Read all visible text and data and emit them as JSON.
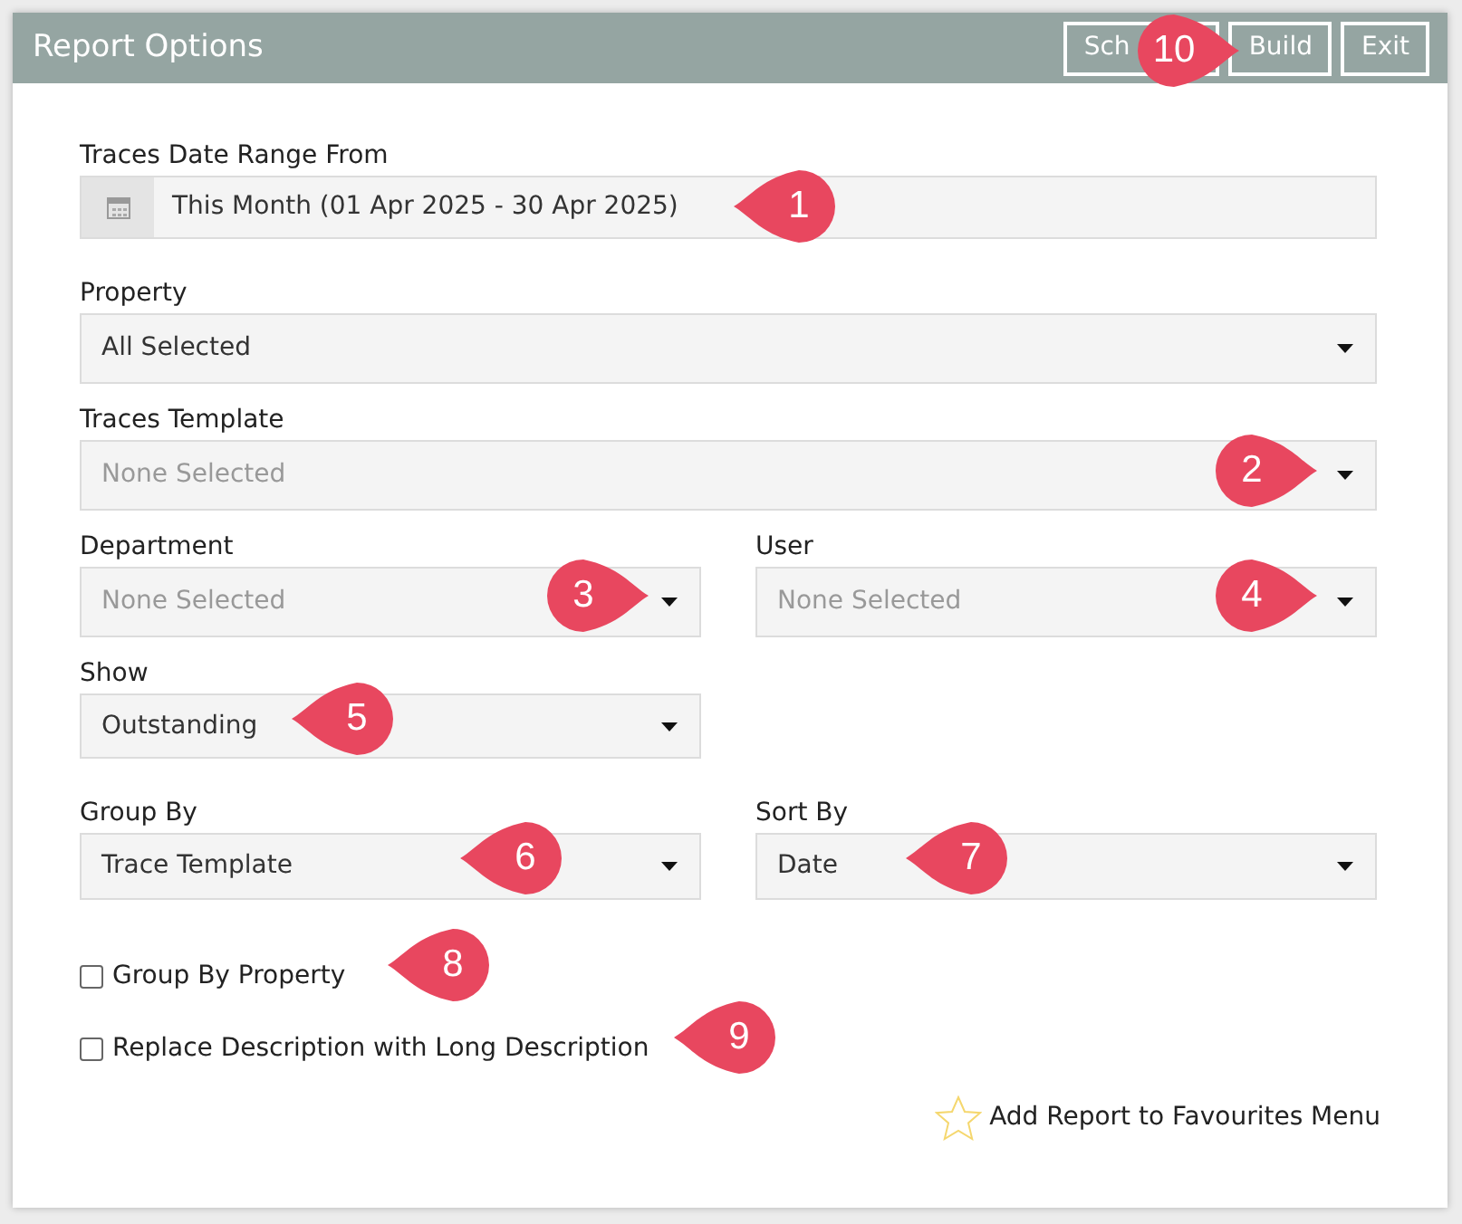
{
  "window": {
    "title": "Report Options"
  },
  "header_buttons": [
    {
      "label": "Sch"
    },
    {
      "label": "Build"
    },
    {
      "label": "Exit"
    }
  ],
  "rows": [
    {
      "kind": "full",
      "fields": [
        {
          "kind": "date",
          "label": "Traces Date Range From",
          "value": "This Month (01 Apr 2025 - 30 Apr 2025)"
        }
      ]
    },
    {
      "kind": "full",
      "fields": [
        {
          "kind": "select",
          "label": "Property",
          "value": "All Selected"
        }
      ]
    },
    {
      "kind": "full",
      "fields": [
        {
          "kind": "select",
          "label": "Traces Template",
          "placeholder": "None Selected"
        }
      ]
    },
    {
      "kind": "pair",
      "fields": [
        {
          "kind": "select",
          "label": "Department",
          "placeholder": "None Selected"
        },
        {
          "kind": "select",
          "label": "User",
          "placeholder": "None Selected"
        }
      ]
    },
    {
      "kind": "half",
      "fields": [
        {
          "kind": "select",
          "label": "Show",
          "value": "Outstanding"
        }
      ]
    },
    {
      "kind": "pair",
      "fields": [
        {
          "kind": "select",
          "label": "Group By",
          "value": "Trace Template"
        },
        {
          "kind": "select",
          "label": "Sort By",
          "value": "Date"
        }
      ]
    }
  ],
  "checkboxes": [
    {
      "label": "Group By Property",
      "checked": false
    },
    {
      "label": "Replace Description with Long Description",
      "checked": false
    }
  ],
  "favourites_link": "Add Report to Favourites Menu",
  "callouts": [
    {
      "number": "1",
      "kind": "leftpin"
    },
    {
      "number": "2",
      "kind": "rightpin"
    },
    {
      "number": "3",
      "kind": "rightpin"
    },
    {
      "number": "4",
      "kind": "rightpin"
    },
    {
      "number": "5",
      "kind": "leftpin"
    },
    {
      "number": "6",
      "kind": "leftpin"
    },
    {
      "number": "7",
      "kind": "leftpin"
    },
    {
      "number": "8",
      "kind": "leftpin"
    },
    {
      "number": "9",
      "kind": "leftpin"
    },
    {
      "number": "10",
      "kind": "rightpin"
    }
  ]
}
